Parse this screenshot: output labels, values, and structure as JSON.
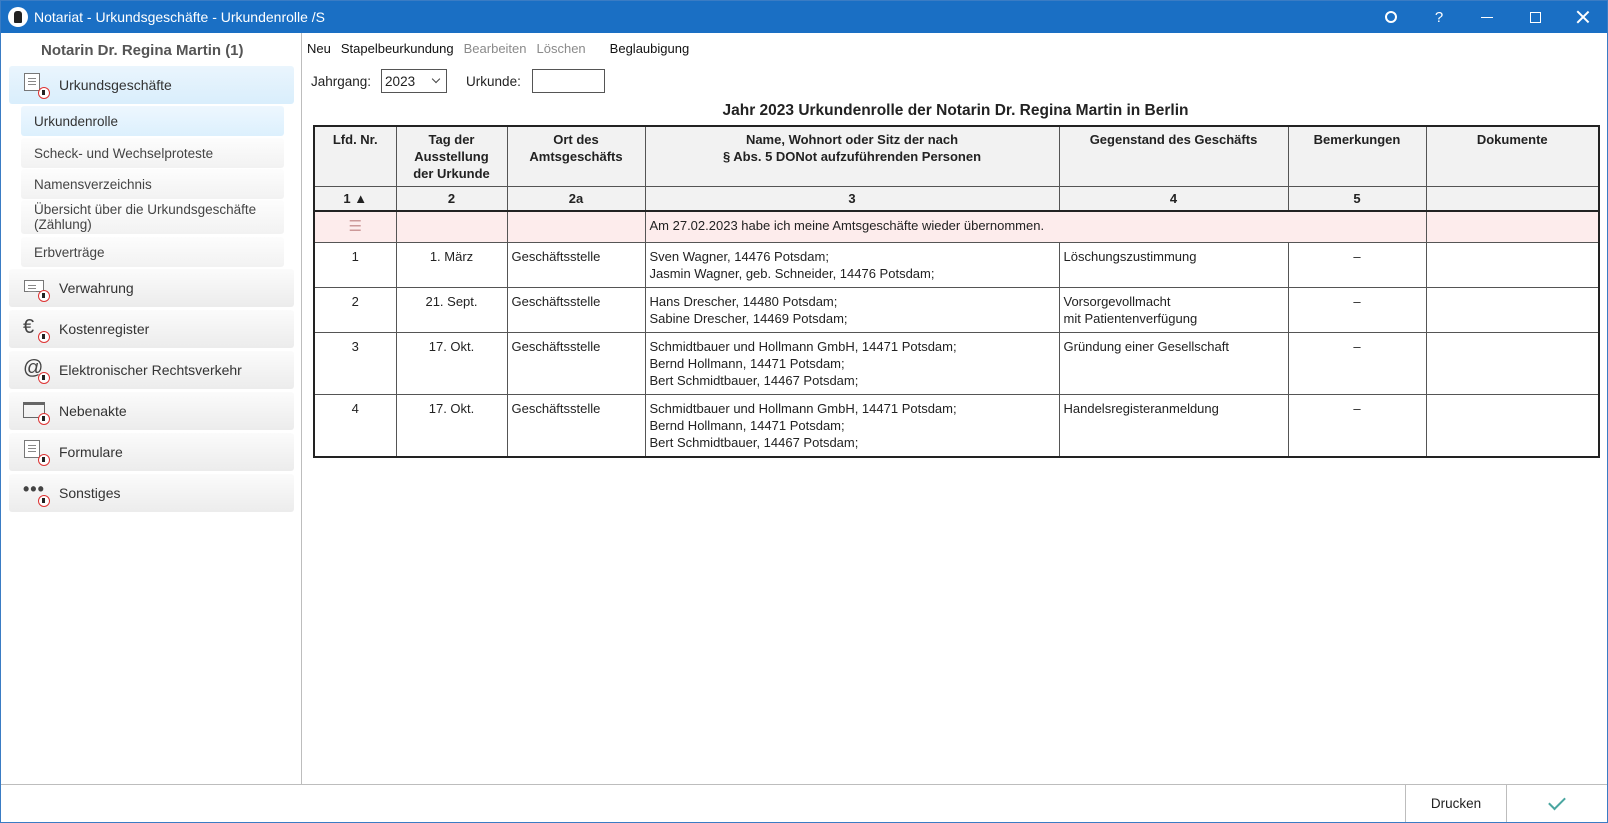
{
  "window": {
    "title": "Notariat - Urkundsgeschäfte - Urkundenrolle /S",
    "controls": {
      "settings": "⚙",
      "help": "?"
    }
  },
  "sidebar": {
    "notary": "Notarin Dr. Regina Martin (1)",
    "groups": [
      {
        "label": "Urkundsgeschäfte",
        "icon": "document-seal-icon",
        "active": true
      },
      {
        "label": "Verwahrung",
        "icon": "cash-register-icon"
      },
      {
        "label": "Kostenregister",
        "icon": "euro-icon"
      },
      {
        "label": "Elektronischer Rechtsverkehr",
        "icon": "at-icon"
      },
      {
        "label": "Nebenakte",
        "icon": "folder-icon"
      },
      {
        "label": "Formulare",
        "icon": "form-icon"
      },
      {
        "label": "Sonstiges",
        "icon": "more-icon"
      }
    ],
    "sub_items": [
      {
        "label": "Urkundenrolle",
        "active": true
      },
      {
        "label": "Scheck- und Wechselproteste"
      },
      {
        "label": "Namensverzeichnis"
      },
      {
        "label": "Übersicht über die Urkundsgeschäfte (Zählung)"
      },
      {
        "label": "Erbverträge"
      }
    ]
  },
  "menu": {
    "new": "Neu",
    "batch": "Stapelbeurkundung",
    "edit": "Bearbeiten",
    "delete": "Löschen",
    "certify": "Beglaubigung"
  },
  "filters": {
    "year_label": "Jahrgang:",
    "year_value": "2023",
    "deed_label": "Urkunde:",
    "deed_value": ""
  },
  "table": {
    "title": "Jahr 2023 Urkundenrolle der Notarin Dr. Regina Martin in Berlin",
    "headers": [
      "Lfd. Nr.",
      "Tag der Ausstellung der Urkunde",
      "Ort des Amtsgeschäfts",
      "Name, Wohnort oder Sitz der nach § Abs. 5 DONot aufzuführenden Personen",
      "Gegenstand des Geschäfts",
      "Bemerkungen",
      "Dokumente"
    ],
    "header_lines": {
      "col1": [
        "Tag der",
        "Ausstellung",
        "der Urkunde"
      ],
      "col2": [
        "Ort des",
        "Amtsgeschäfts"
      ],
      "col3": [
        "Name, Wohnort oder Sitz der nach",
        "§ Abs. 5 DONot aufzuführenden Personen"
      ]
    },
    "column_numbers": [
      "1 ▲",
      "2",
      "2a",
      "3",
      "4",
      "5",
      ""
    ],
    "note": "Am 27.02.2023 habe ich meine Amtsgeschäfte wieder übernommen.",
    "rows": [
      {
        "nr": "1",
        "date": "1. März",
        "place": "Geschäftsstelle",
        "persons": [
          "Sven Wagner, 14476 Potsdam;",
          "Jasmin Wagner, geb. Schneider, 14476 Potsdam;"
        ],
        "subject": [
          "Löschungszustimmung"
        ],
        "remarks": "–",
        "docs": ""
      },
      {
        "nr": "2",
        "date": "21. Sept.",
        "place": "Geschäftsstelle",
        "persons": [
          "Hans Drescher, 14480 Potsdam;",
          "Sabine Drescher, 14469 Potsdam;"
        ],
        "subject": [
          "Vorsorgevollmacht",
          "mit Patientenverfügung"
        ],
        "remarks": "–",
        "docs": ""
      },
      {
        "nr": "3",
        "date": "17. Okt.",
        "place": "Geschäftsstelle",
        "persons": [
          "Schmidtbauer und Hollmann GmbH, 14471 Potsdam;",
          "Bernd Hollmann, 14471 Potsdam;",
          "Bert Schmidtbauer, 14467 Potsdam;"
        ],
        "subject": [
          "Gründung einer Gesellschaft"
        ],
        "remarks": "–",
        "docs": ""
      },
      {
        "nr": "4",
        "date": "17. Okt.",
        "place": "Geschäftsstelle",
        "persons": [
          "Schmidtbauer und Hollmann GmbH, 14471 Potsdam;",
          "Bernd Hollmann, 14471 Potsdam;",
          "Bert Schmidtbauer, 14467 Potsdam;"
        ],
        "subject": [
          "Handelsregisteranmeldung"
        ],
        "remarks": "–",
        "docs": ""
      }
    ]
  },
  "footer": {
    "print": "Drucken"
  },
  "colors": {
    "titlebar": "#1a6fc4",
    "note_row": "#fdecec",
    "active_nav": "#dcf0fd",
    "ok_check": "#4aa6a0"
  }
}
